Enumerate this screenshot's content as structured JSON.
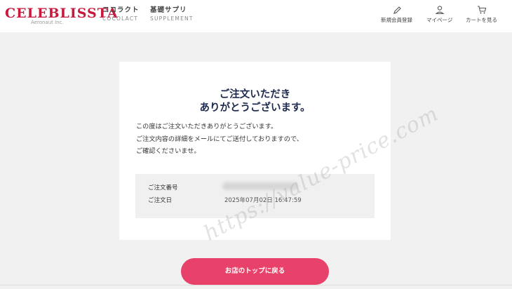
{
  "header": {
    "logo": "CELEBLISSTA",
    "logo_sub": "Aeronaut Inc.",
    "nav": [
      {
        "jp": "ココラクト",
        "en": "COCOLACT"
      },
      {
        "jp": "基礎サプリ",
        "en": "SUPPLEMENT"
      }
    ],
    "utilities": [
      {
        "label": "新規会員登録",
        "icon": "pencil-icon"
      },
      {
        "label": "マイページ",
        "icon": "user-icon"
      },
      {
        "label": "カートを見る",
        "icon": "cart-icon"
      }
    ]
  },
  "confirmation": {
    "heading_line1": "ご注文いただき",
    "heading_line2": "ありがとうございます。",
    "message_lines": [
      "この度はご注文いただきありがとうございます。",
      "ご注文内容の詳細をメールにてご送付しておりますので、",
      "ご確認くださいませ。"
    ],
    "order_number_label": "ご注文番号",
    "order_date_label": "ご注文日",
    "order_date_value": "2025年07月02日 16:47:59"
  },
  "watermark": "https://value-price.com",
  "back_button_label": "お店のトップに戻る",
  "colors": {
    "brand": "#c8193c",
    "button": "#e8426a",
    "heading": "#1d2a4d"
  }
}
